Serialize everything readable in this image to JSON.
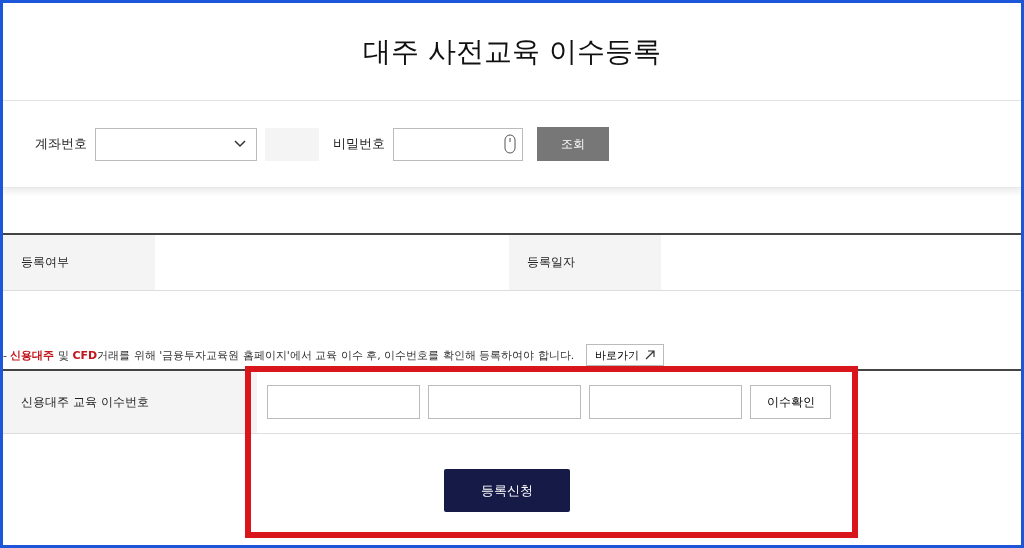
{
  "title": "대주 사전교육 이수등록",
  "search": {
    "account_label": "계좌번호",
    "password_label": "비밀번호",
    "button": "조회"
  },
  "status_table": [
    {
      "label": "등록여부"
    },
    {
      "label": "등록일자"
    }
  ],
  "notice": {
    "segments": [
      {
        "text": "- ",
        "highlight": false
      },
      {
        "text": "신용대주",
        "highlight": true
      },
      {
        "text": " 및 ",
        "highlight": false
      },
      {
        "text": "CFD",
        "highlight": true
      },
      {
        "text": "거래를 위해 '금융투자교육원 홈페이지'에서 교육 이수 후, 이수번호를 확인해 등록하여야 합니다.",
        "highlight": false
      }
    ],
    "link": "바로가기"
  },
  "certificate": {
    "label": "신용대주 교육 이수번호",
    "button": "이수확인"
  },
  "submit": "등록신청"
}
